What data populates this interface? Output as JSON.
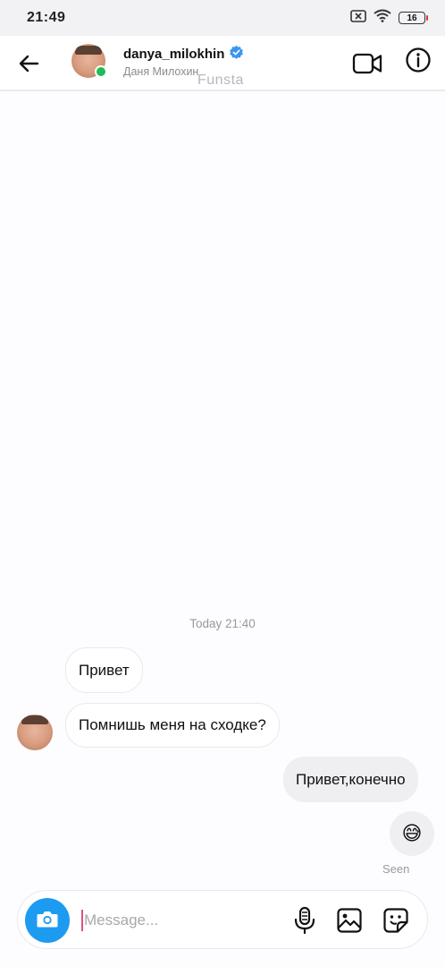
{
  "status_bar": {
    "time": "21:49",
    "battery": "16",
    "icons": [
      "sim-off-icon",
      "wifi-icon",
      "battery-icon"
    ]
  },
  "header": {
    "username": "danya_milokhin",
    "subtitle": "Даня Милохин",
    "verified": true,
    "online": true,
    "watermark": "Funsta",
    "icons": [
      "back-arrow-icon",
      "video-call-icon",
      "info-icon"
    ]
  },
  "conversation": {
    "timestamp": "Today 21:40",
    "messages": [
      {
        "direction": "incoming",
        "text": "Привет"
      },
      {
        "direction": "incoming",
        "text": "Помнишь меня на сходке?"
      },
      {
        "direction": "outgoing",
        "text": "Привет,конечно"
      },
      {
        "direction": "outgoing",
        "text": "😅"
      }
    ],
    "seen_label": "Seen"
  },
  "composer": {
    "placeholder": "Message...",
    "value": "",
    "icons": [
      "camera-icon",
      "microphone-icon",
      "gallery-icon",
      "sticker-icon"
    ]
  },
  "colors": {
    "accent": "#1d9bf0",
    "online": "#22bb55",
    "outgoing_bubble": "#efeef0",
    "background": "#fdfcfe"
  }
}
